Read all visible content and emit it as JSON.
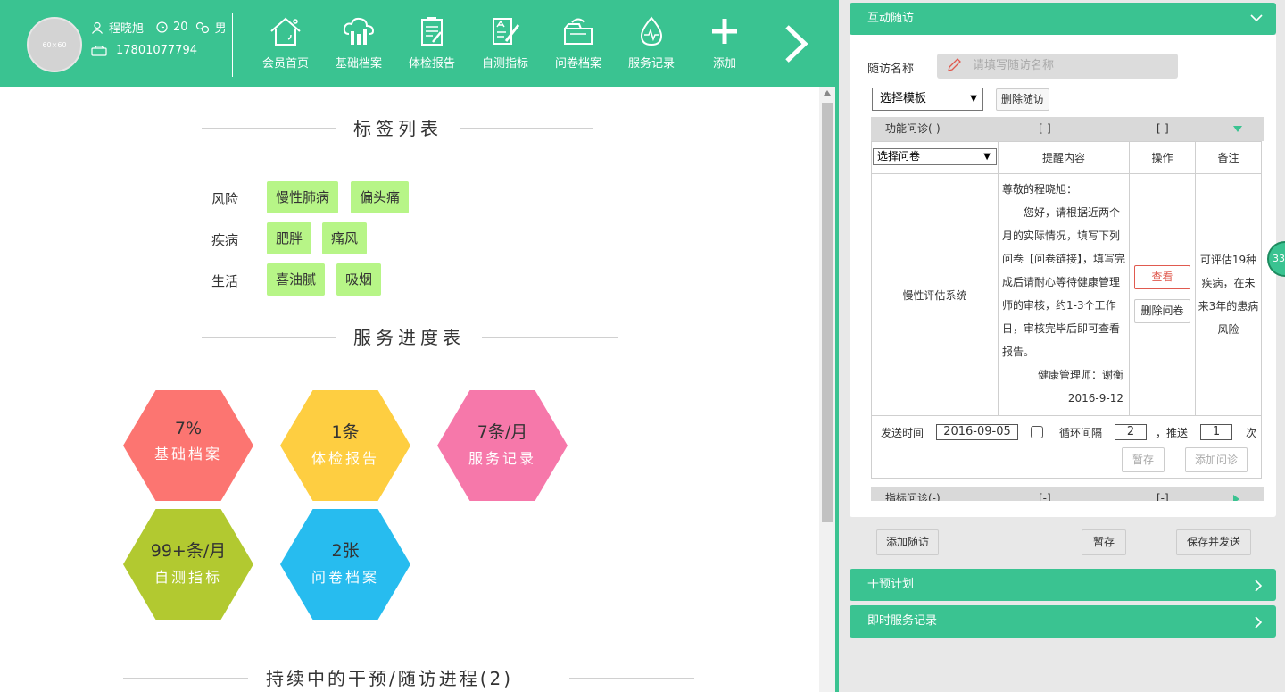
{
  "user": {
    "name": "程晓旭",
    "age": "20",
    "gender": "男",
    "phone": "17801077794",
    "avatar_text": "60×60"
  },
  "nav": {
    "items": [
      {
        "label": "会员首页",
        "icon": "house-icon"
      },
      {
        "label": "基础档案",
        "icon": "cloud-chart-icon"
      },
      {
        "label": "体检报告",
        "icon": "clipboard-icon"
      },
      {
        "label": "自测指标",
        "icon": "pen-paper-icon"
      },
      {
        "label": "问卷档案",
        "icon": "folder-tray-icon"
      },
      {
        "label": "服务记录",
        "icon": "heartbeat-drop-icon"
      },
      {
        "label": "添加",
        "icon": "plus-icon"
      }
    ],
    "next_icon": "chevron-right-icon"
  },
  "tags": {
    "title": "标签列表",
    "rows": [
      {
        "label": "风险",
        "items": [
          "慢性肺病",
          "偏头痛"
        ]
      },
      {
        "label": "疾病",
        "items": [
          "肥胖",
          "痛风"
        ]
      },
      {
        "label": "生活",
        "items": [
          "喜油腻",
          "吸烟"
        ]
      }
    ]
  },
  "progress": {
    "title": "服务进度表",
    "items": [
      {
        "value": "7%",
        "name": "基础档案",
        "color": "#fc7571"
      },
      {
        "value": "1条",
        "name": "体检报告",
        "color": "#fece41"
      },
      {
        "value": "7条/月",
        "name": "服务记录",
        "color": "#f678aa"
      },
      {
        "value": "99+条/月",
        "name": "自测指标",
        "color": "#b2c930"
      },
      {
        "value": "2张",
        "name": "问卷档案",
        "color": "#27bcef"
      }
    ]
  },
  "ongoing": {
    "title": "持续中的干预/随访进程(2)"
  },
  "right": {
    "interactive_followup": {
      "title": "互动随访",
      "name_label": "随访名称",
      "name_placeholder": "请填写随访名称",
      "template_select": "选择模板",
      "delete_followup": "删除随访",
      "section1": {
        "title": "功能问诊(-)",
        "col2": "[-]",
        "col3": "[-]"
      },
      "questionnaire_select": "选择问卷",
      "headers": {
        "content": "提醒内容",
        "action": "操作",
        "note": "备注"
      },
      "row": {
        "system": "慢性评估系统",
        "msg_greeting": "尊敬的程晓旭：",
        "msg_body": "您好，请根据近两个月的实际情况，填写下列问卷【问卷链接】，填写完成后请耐心等待健康管理师的审核，约1-3个工作日，审核完毕后即可查看报告。",
        "msg_sign": "健康管理师：谢衡",
        "msg_date": "2016-9-12",
        "view_btn": "查看",
        "delete_btn": "删除问卷",
        "note": "可评估19种疾病，在未来3年的患病风险"
      },
      "send_time_label": "发送时间",
      "send_time": "2016-09-05",
      "loop_label": "循环间隔",
      "loop_value": "2",
      "push_label": "，推送",
      "push_value": "1",
      "times_label": "次",
      "save_temp": "暂存",
      "add_consult": "添加问诊",
      "section2": {
        "title": "指标问诊(-)",
        "col2": "[-]",
        "col3": "[-]"
      }
    },
    "bottom_buttons": {
      "add": "添加随访",
      "save": "暂存",
      "save_send": "保存并发送"
    },
    "intervention_plan": "干预计划",
    "instant_records": "即时服务记录"
  },
  "side_badge": "33",
  "colors": {
    "brand": "#3ac391",
    "tag_bg": "#b7f587"
  }
}
